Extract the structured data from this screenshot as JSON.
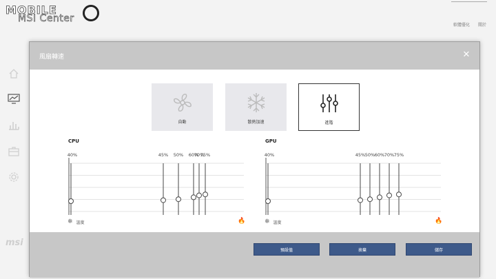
{
  "app": {
    "logo_top": "MOBILE",
    "logo_bottom": "MSI Center",
    "top_links": [
      "軟體優化",
      "關於"
    ],
    "side_brand": "msi"
  },
  "dialog": {
    "title": "風扇轉速",
    "modes": [
      {
        "label": "自動",
        "icon": "fan-icon",
        "active": false
      },
      {
        "label": "散熱加速",
        "icon": "snowflake-icon",
        "active": false
      },
      {
        "label": "進階",
        "icon": "sliders-icon",
        "active": true
      }
    ],
    "cpu": {
      "title": "CPU",
      "temp_label": "溫度",
      "points": [
        {
          "label": "40%",
          "value": 40
        },
        {
          "label": "45%",
          "value": 45
        },
        {
          "label": "50%",
          "value": 50
        },
        {
          "label": "60%",
          "value": 60
        },
        {
          "label": "70%",
          "value": 70
        },
        {
          "label": "75%",
          "value": 75
        }
      ]
    },
    "gpu": {
      "title": "GPU",
      "temp_label": "溫度",
      "points": [
        {
          "label": "40%",
          "value": 40
        },
        {
          "label": "45%",
          "value": 45
        },
        {
          "label": "50%",
          "value": 50
        },
        {
          "label": "60%",
          "value": 60
        },
        {
          "label": "70%",
          "value": 70
        },
        {
          "label": "75%",
          "value": 75
        }
      ]
    },
    "buttons": {
      "default": "預設值",
      "cancel": "捨棄",
      "save": "儲存"
    }
  }
}
